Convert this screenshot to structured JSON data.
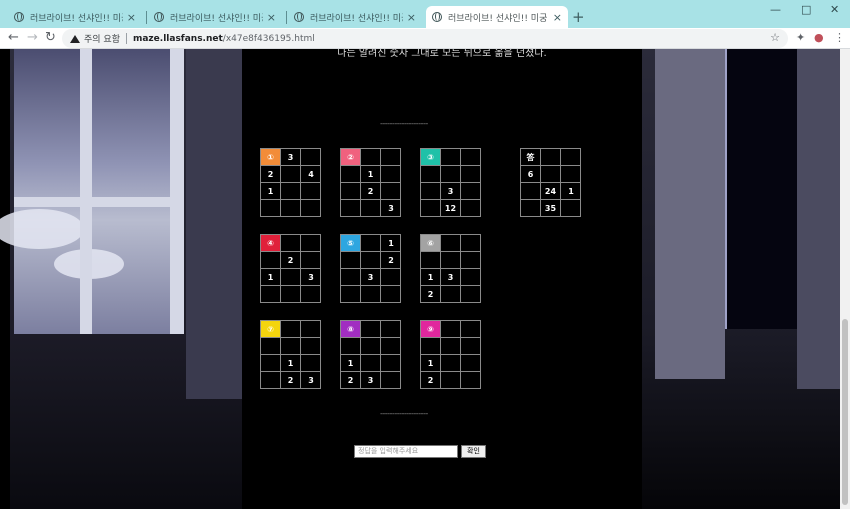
{
  "browser": {
    "tabs": [
      {
        "title": "러브라이브! 선샤인!! 미궁",
        "close": "×"
      },
      {
        "title": "러브라이브! 선샤인!! 미궁",
        "close": "×"
      },
      {
        "title": "러브라이브! 선샤인!! 미궁",
        "close": "×"
      },
      {
        "title": "러브라이브! 선샤인!! 미궁",
        "close": "×"
      }
    ],
    "new_tab": "+",
    "security_warning": "주의 요함",
    "url_host": "maze.llasfans.net",
    "url_path": "/x47e8f436195.html"
  },
  "page": {
    "story_text": "나는 알려진 숫자 그대로 모든 뒤으로 옮을 던졌다.",
    "divider_top": "--------------------",
    "divider_bottom": "--------------------",
    "puzzles": [
      {
        "label": "①",
        "color": "#f28c38",
        "cells": [
          "",
          "3",
          "",
          "2",
          "",
          "4",
          "1",
          "",
          "",
          "",
          "",
          ""
        ]
      },
      {
        "label": "②",
        "color": "#f0617e",
        "cells": [
          "",
          "",
          "",
          "",
          "1",
          "",
          "",
          "2",
          "",
          "",
          "",
          "3"
        ]
      },
      {
        "label": "③",
        "color": "#1fc1a8",
        "cells": [
          "",
          "",
          "",
          "",
          "",
          "",
          "",
          "3",
          "",
          "",
          "12",
          ""
        ]
      },
      {
        "label": "④",
        "color": "#e0203a",
        "cells": [
          "",
          "",
          "",
          "",
          "2",
          "",
          "1",
          "",
          "3",
          "",
          "",
          ""
        ]
      },
      {
        "label": "⑤",
        "color": "#2ea6e0",
        "cells": [
          "",
          "",
          "1",
          "",
          "",
          "2",
          "",
          "3",
          "",
          "",
          "",
          ""
        ]
      },
      {
        "label": "⑥",
        "color": "#a3a3a3",
        "cells": [
          "",
          "",
          "",
          "",
          "",
          "",
          "1",
          "3",
          "",
          "2",
          "",
          ""
        ]
      },
      {
        "label": "⑦",
        "color": "#f4d40e",
        "cells": [
          "",
          "",
          "",
          "",
          "",
          "",
          "",
          "1",
          "",
          "",
          "2",
          "3"
        ]
      },
      {
        "label": "⑧",
        "color": "#a12ec1",
        "cells": [
          "",
          "",
          "",
          "",
          "",
          "",
          "1",
          "",
          "",
          "2",
          "3",
          ""
        ]
      },
      {
        "label": "⑨",
        "color": "#e0279d",
        "cells": [
          "",
          "",
          "",
          "",
          "",
          "",
          "1",
          "",
          "",
          "2",
          "",
          ""
        ]
      },
      {
        "label": "答",
        "color": "#000000",
        "cells": [
          "",
          "",
          "",
          "6",
          "",
          "",
          "",
          "24",
          "1",
          "",
          "35",
          ""
        ]
      }
    ],
    "answer_placeholder": "정답을 입력해주세요",
    "submit_label": "확인"
  }
}
